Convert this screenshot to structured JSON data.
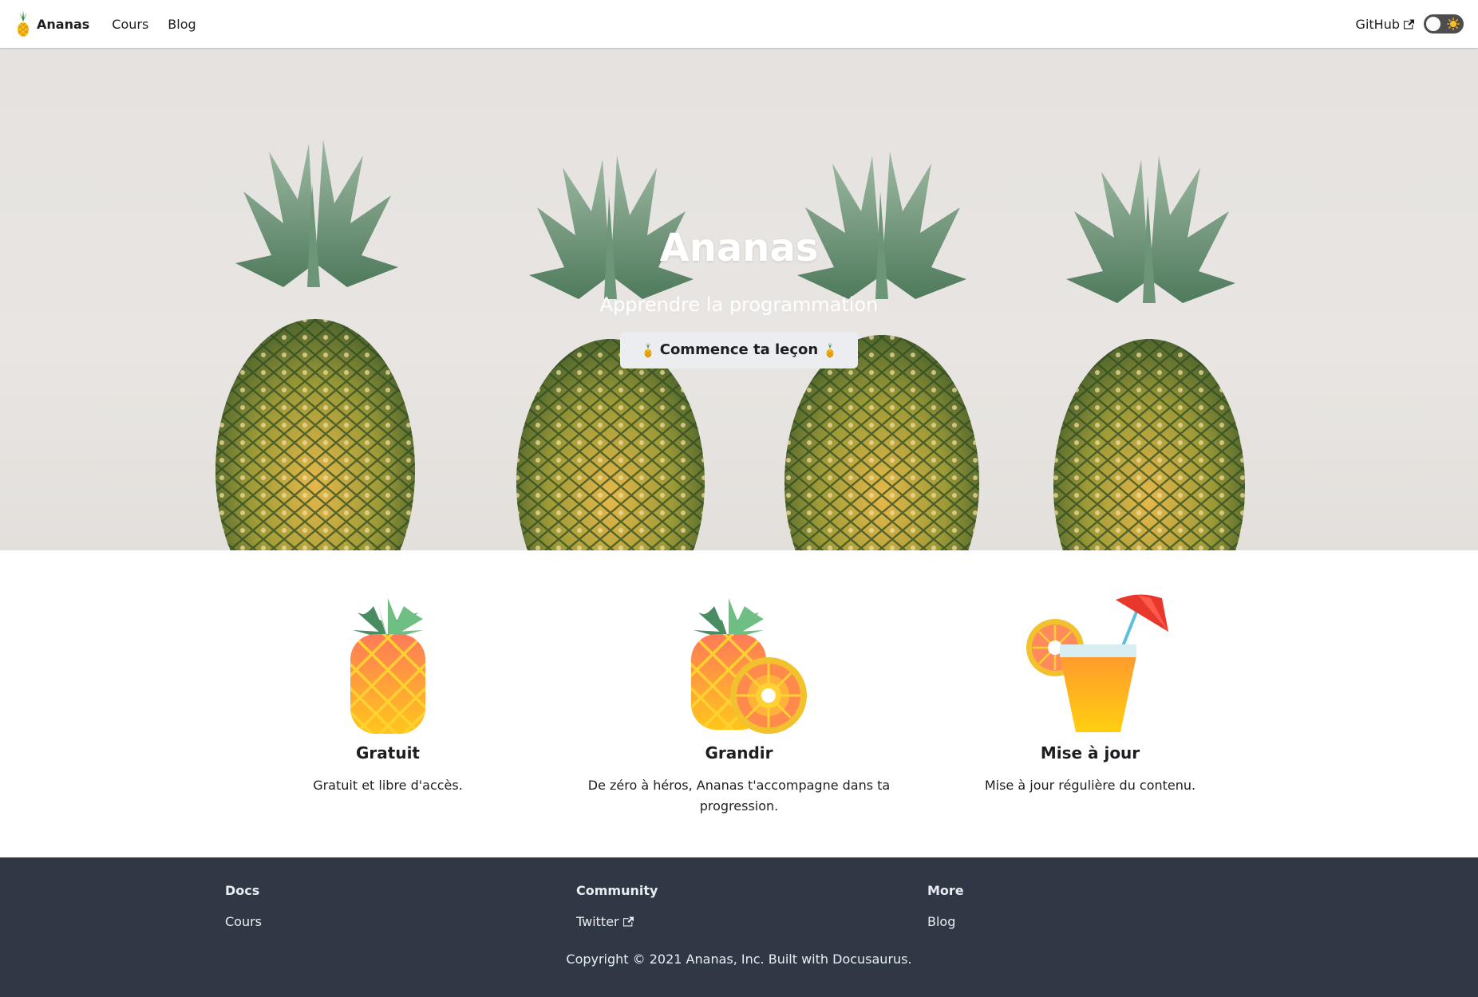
{
  "navbar": {
    "brand_title": "Ananas",
    "links": [
      {
        "label": "Cours"
      },
      {
        "label": "Blog"
      }
    ],
    "github_label": "GitHub",
    "theme_toggle_icon": "sun-icon"
  },
  "hero": {
    "title": "Ananas",
    "subtitle": "Apprendre la programmation",
    "button_label": "Commence ta leçon"
  },
  "features": [
    {
      "icon": "pineapple-icon",
      "title": "Gratuit",
      "description": "Gratuit et libre d'accès."
    },
    {
      "icon": "pineapple-slice-icon",
      "title": "Grandir",
      "description": "De zéro à héros, Ananas t'accompagne dans ta progression."
    },
    {
      "icon": "cocktail-icon",
      "title": "Mise à jour",
      "description": "Mise à jour régulière du contenu."
    }
  ],
  "footer": {
    "columns": [
      {
        "title": "Docs",
        "links": [
          {
            "label": "Cours",
            "external": false
          }
        ]
      },
      {
        "title": "Community",
        "links": [
          {
            "label": "Twitter",
            "external": true
          }
        ]
      },
      {
        "title": "More",
        "links": [
          {
            "label": "Blog",
            "external": false
          }
        ]
      }
    ],
    "copyright": "Copyright © 2021 Ananas, Inc. Built with Docusaurus."
  },
  "colors": {
    "footer_bg": "#303846",
    "hero_bg": "#e5e2df",
    "button_bg": "#ebedf0",
    "pineapple_orange": "#ff8c5a",
    "pineapple_yellow": "#ffc107",
    "leaf_green": "#4a8c62"
  }
}
